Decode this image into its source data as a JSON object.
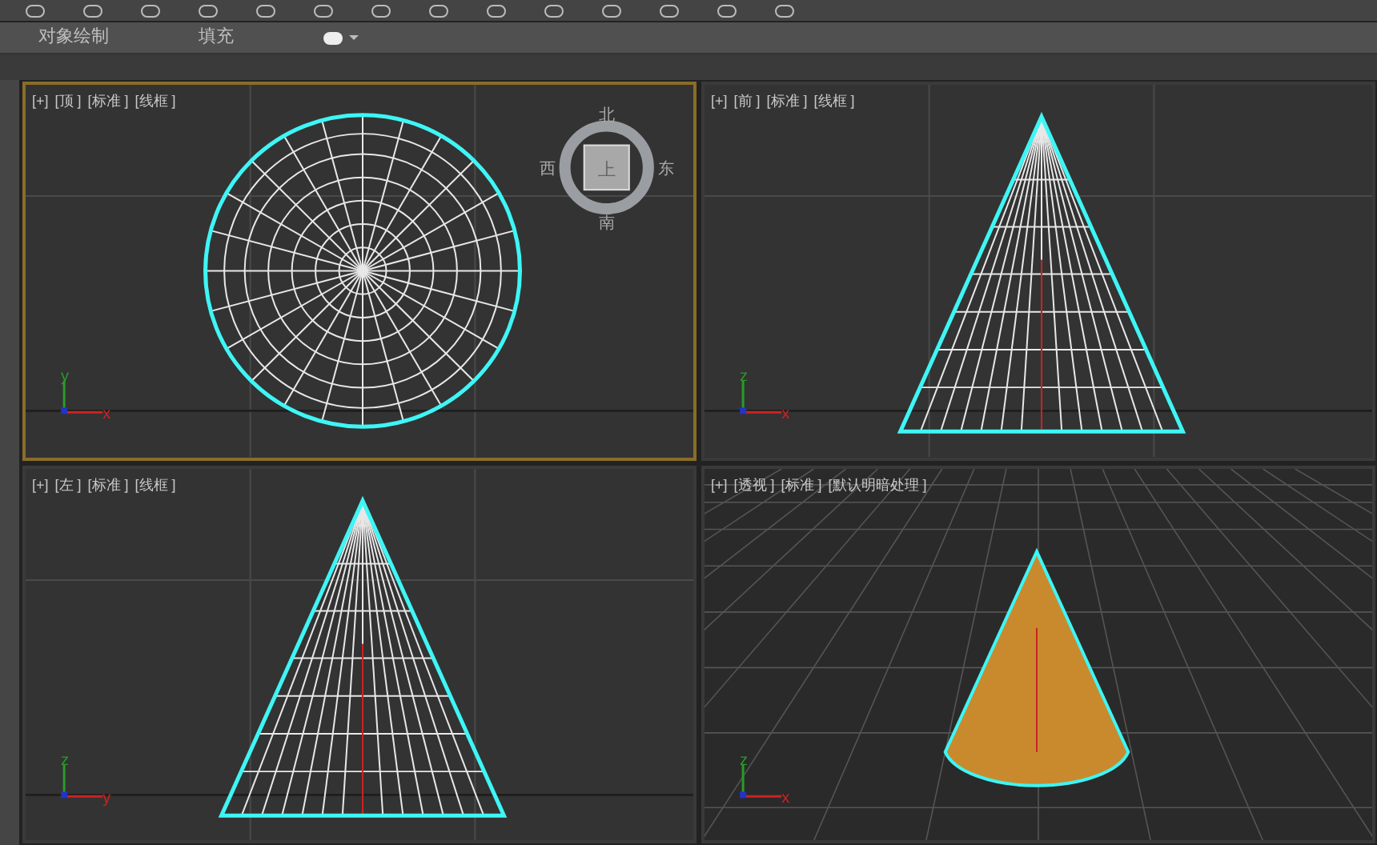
{
  "ribbon": {
    "tabs": [
      "对象绘制",
      "填充"
    ]
  },
  "viewports": [
    {
      "kind": "top",
      "selected": true,
      "labels": [
        "[+]",
        "[顶 ]",
        "[标准 ]",
        "[线框 ]"
      ],
      "axes": [
        "y",
        "x"
      ],
      "viewcube": {
        "north": "北",
        "west": "西",
        "face": "上",
        "east": "东",
        "south": "南"
      }
    },
    {
      "kind": "front",
      "selected": false,
      "labels": [
        "[+]",
        "[前 ]",
        "[标准 ]",
        "[线框 ]"
      ],
      "axes": [
        "z",
        "x"
      ]
    },
    {
      "kind": "left",
      "selected": false,
      "labels": [
        "[+]",
        "[左 ]",
        "[标准 ]",
        "[线框 ]"
      ],
      "axes": [
        "z",
        "y"
      ]
    },
    {
      "kind": "perspective",
      "selected": false,
      "labels": [
        "[+]",
        "[透视 ]",
        "[标准 ]",
        "[默认明暗处理 ]"
      ],
      "axes": [
        "z",
        "x"
      ]
    }
  ]
}
